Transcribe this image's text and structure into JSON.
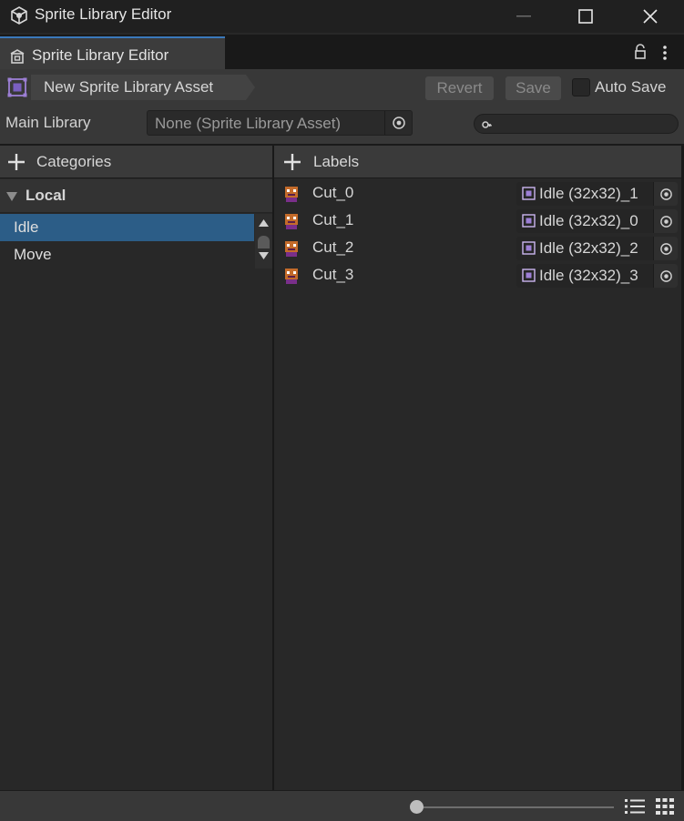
{
  "window": {
    "title": "Sprite Library Editor",
    "icons": [
      "unity-cube-icon",
      "minimize-icon",
      "maximize-icon",
      "close-icon"
    ]
  },
  "tab": {
    "label": "Sprite Library Editor"
  },
  "toolbar": {
    "asset_name": "New Sprite Library Asset",
    "revert_label": "Revert",
    "save_label": "Save",
    "autosave_label": "Auto Save",
    "autosave_checked": false
  },
  "library": {
    "label": "Main Library",
    "value": "None (Sprite Library Asset)",
    "search_placeholder": ""
  },
  "categories": {
    "header": "Categories",
    "group": "Local",
    "items": [
      {
        "label": "Idle",
        "selected": true
      },
      {
        "label": "Move",
        "selected": false
      }
    ]
  },
  "labels": {
    "header": "Labels",
    "items": [
      {
        "name": "Cut_0",
        "sprite": "Idle (32x32)_1"
      },
      {
        "name": "Cut_1",
        "sprite": "Idle (32x32)_0"
      },
      {
        "name": "Cut_2",
        "sprite": "Idle (32x32)_2"
      },
      {
        "name": "Cut_3",
        "sprite": "Idle (32x32)_3"
      }
    ]
  },
  "footer": {
    "zoom_fraction": 0.0
  },
  "colors": {
    "selection": "#2c5d87",
    "tab_accent": "#3a79bb",
    "asset_icon": "#9d7fd6",
    "background": "#282828"
  }
}
